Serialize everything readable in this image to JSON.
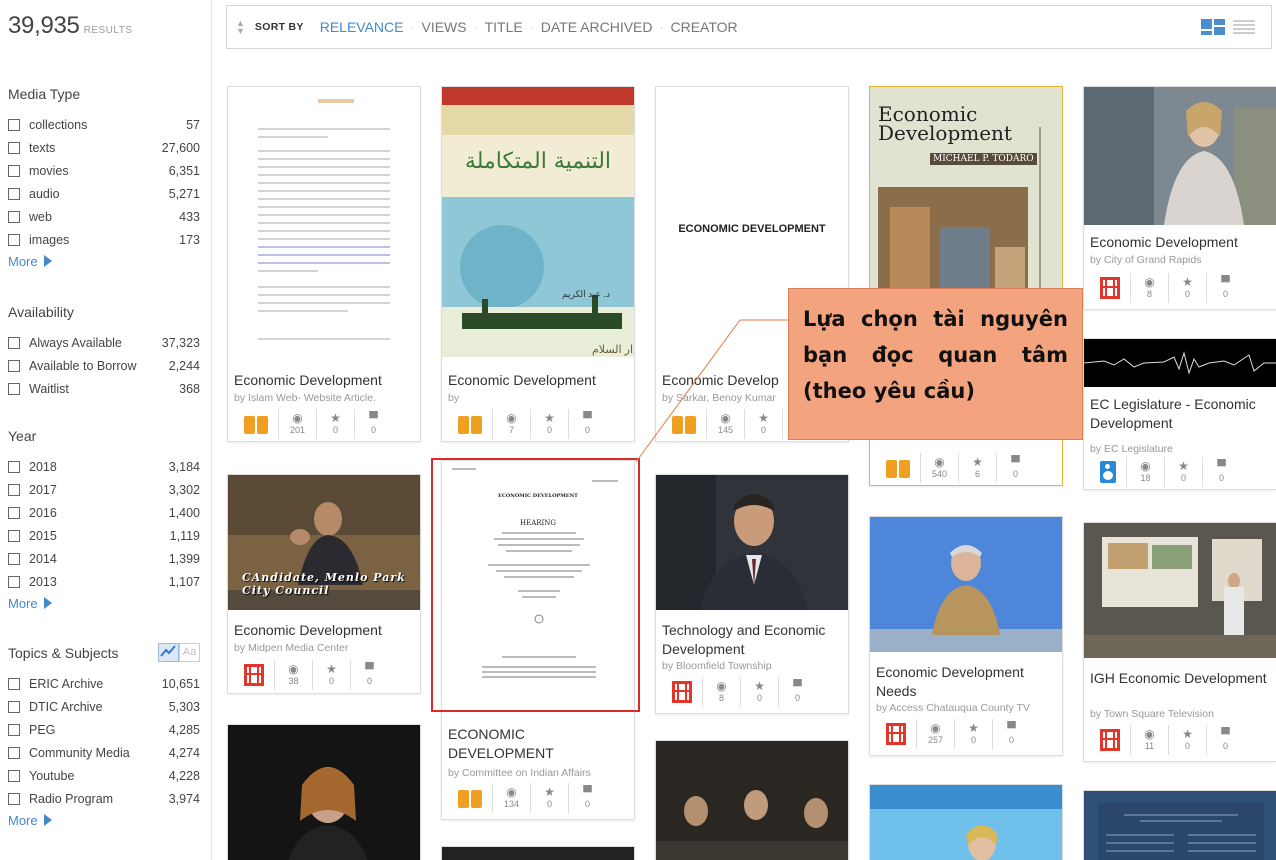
{
  "results": {
    "count": "39,935",
    "label": "RESULTS"
  },
  "facets": {
    "media_type": {
      "title": "Media Type",
      "items": [
        {
          "name": "collections",
          "count": "57"
        },
        {
          "name": "texts",
          "count": "27,600"
        },
        {
          "name": "movies",
          "count": "6,351"
        },
        {
          "name": "audio",
          "count": "5,271"
        },
        {
          "name": "web",
          "count": "433"
        },
        {
          "name": "images",
          "count": "173"
        }
      ],
      "more": "More"
    },
    "availability": {
      "title": "Availability",
      "items": [
        {
          "name": "Always Available",
          "count": "37,323"
        },
        {
          "name": "Available to Borrow",
          "count": "2,244"
        },
        {
          "name": "Waitlist",
          "count": "368"
        }
      ]
    },
    "year": {
      "title": "Year",
      "items": [
        {
          "name": "2018",
          "count": "3,184"
        },
        {
          "name": "2017",
          "count": "3,302"
        },
        {
          "name": "2016",
          "count": "1,400"
        },
        {
          "name": "2015",
          "count": "1,119"
        },
        {
          "name": "2014",
          "count": "1,399"
        },
        {
          "name": "2013",
          "count": "1,107"
        }
      ],
      "more": "More"
    },
    "topics": {
      "title": "Topics & Subjects",
      "toggle_text": "Aa",
      "items": [
        {
          "name": "ERIC Archive",
          "count": "10,651"
        },
        {
          "name": "DTIC Archive",
          "count": "5,303"
        },
        {
          "name": "PEG",
          "count": "4,285"
        },
        {
          "name": "Community Media",
          "count": "4,274"
        },
        {
          "name": "Youtube",
          "count": "4,228"
        },
        {
          "name": "Radio Program",
          "count": "3,974"
        }
      ],
      "more": "More"
    }
  },
  "sortbar": {
    "sort_by": "SORT BY",
    "options": [
      "RELEVANCE",
      "VIEWS",
      "TITLE",
      "DATE ARCHIVED",
      "CREATOR"
    ],
    "active": "RELEVANCE"
  },
  "cards": [
    {
      "title": "Economic Development",
      "by": "by Islam Web- Website Article.",
      "views": "201",
      "favs": "0",
      "reviews": "0",
      "type": "texts"
    },
    {
      "title": "Economic Development",
      "by": "by",
      "views": "7",
      "favs": "0",
      "reviews": "0",
      "type": "texts",
      "thumb_text": "التنمية المتكاملة"
    },
    {
      "title": "Economic Develop",
      "by": "by Sarkar, Benoy Kumar",
      "views": "145",
      "favs": "0",
      "reviews": "0",
      "type": "texts",
      "thumb_text": "ECONOMIC DEVELOPMENT"
    },
    {
      "title": "",
      "by": "",
      "views": "540",
      "favs": "6",
      "reviews": "0",
      "type": "texts",
      "thumb_title": "Economic Development",
      "thumb_author": "MICHAEL P. TODARO"
    },
    {
      "title": "Economic Development",
      "by": "by City of Grand Rapids",
      "views": "8",
      "favs": "0",
      "reviews": "0",
      "type": "movies"
    },
    {
      "title": "EC Legislature - Economic Development",
      "by": "by EC Legislature",
      "views": "18",
      "favs": "0",
      "reviews": "0",
      "type": "audio"
    },
    {
      "title": "Economic Development",
      "by": "by Midpen Media Center",
      "views": "38",
      "favs": "0",
      "reviews": "0",
      "type": "movies",
      "thumb_caption_1": "CAndidate, Menlo Park",
      "thumb_caption_2": "City Council"
    },
    {
      "title": "ECONOMIC DEVELOPMENT",
      "by": "by Committee on Indian Affairs",
      "views": "134",
      "favs": "0",
      "reviews": "0",
      "type": "texts",
      "thumb_head": "ECONOMIC DEVELOPMENT",
      "thumb_sub": "HEARING"
    },
    {
      "title": "Technology and Economic Development",
      "by": "by Bloomfield Township",
      "views": "8",
      "favs": "0",
      "reviews": "0",
      "type": "movies"
    },
    {
      "title": "Economic Development Needs",
      "by": "by Access Chatauqua County TV",
      "views": "257",
      "favs": "0",
      "reviews": "0",
      "type": "movies"
    },
    {
      "title": "IGH Economic Development",
      "by": "by Town Square Television",
      "views": "11",
      "favs": "0",
      "reviews": "0",
      "type": "movies"
    }
  ],
  "callout": {
    "text": "Lựa chọn tài nguyên bạn đọc quan tâm (theo yêu cầu)"
  },
  "colors": {
    "accent": "#428bca",
    "texts": "#f0a020",
    "movies": "#e0362c",
    "audio": "#2a86d6",
    "highlight": "#d92b2b",
    "callout": "#f3a37e"
  }
}
